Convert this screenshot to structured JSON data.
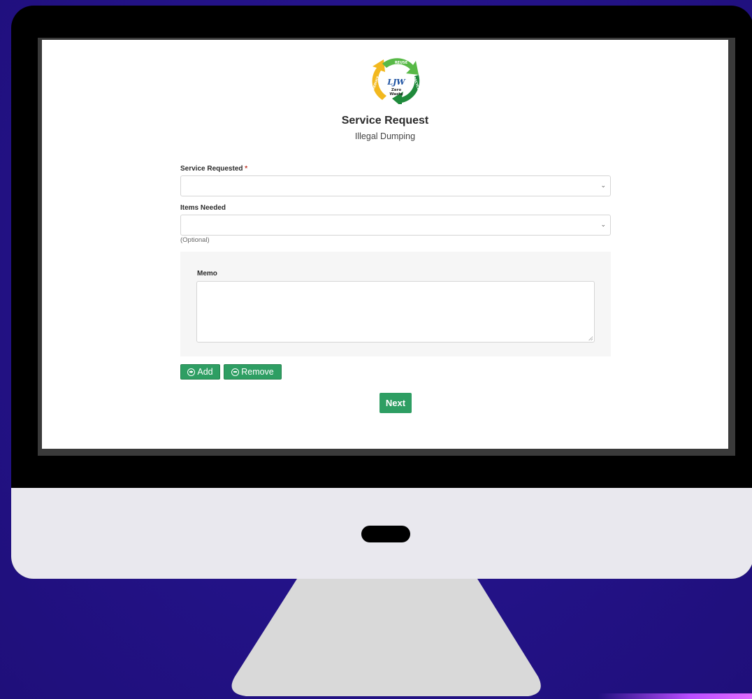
{
  "brand": {
    "logo_initials": "LJW",
    "logo_caption_1": "Zero",
    "logo_caption_2": "Waste",
    "logo_word_top": "REUSE",
    "logo_word_left": "REDUCE",
    "logo_word_right": "RECYCLE"
  },
  "header": {
    "title": "Service Request",
    "subtitle": "Illegal Dumping"
  },
  "form": {
    "service_requested": {
      "label": "Service Requested",
      "required_mark": "*",
      "value": ""
    },
    "items_needed": {
      "label": "Items Needed",
      "value": "",
      "help": "(Optional)"
    },
    "memo": {
      "label": "Memo",
      "value": ""
    }
  },
  "buttons": {
    "add_label": "Add",
    "remove_label": "Remove",
    "next_label": "Next"
  },
  "colors": {
    "background": "#24138a",
    "button_green": "#2e9e63",
    "required_red": "#c0392b"
  }
}
